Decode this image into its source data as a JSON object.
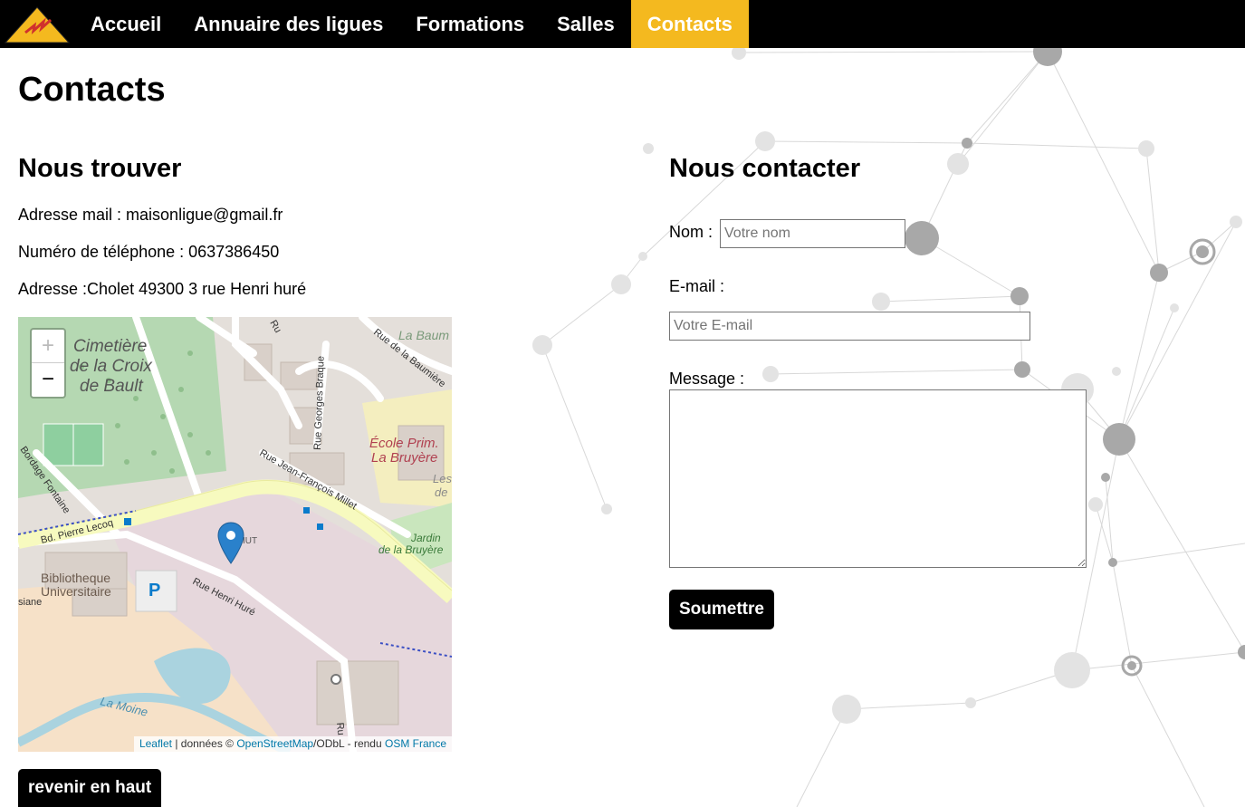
{
  "nav": {
    "items": [
      {
        "label": "Accueil"
      },
      {
        "label": "Annuaire des ligues"
      },
      {
        "label": "Formations"
      },
      {
        "label": "Salles"
      },
      {
        "label": "Contacts"
      }
    ],
    "active": "Contacts",
    "active_color": "#f4b91f",
    "background": "#000000"
  },
  "page": {
    "title": "Contacts"
  },
  "find_us": {
    "title": "Nous trouver",
    "email_line": "Adresse mail : maisonligue@gmail.fr",
    "phone_line": "Numéro de téléphone : 0637386450",
    "address_line": "Adresse :Cholet 49300 3 rue Henri huré"
  },
  "map": {
    "zoom_in": "+",
    "zoom_out": "−",
    "labels": {
      "cemetery_1": "Cimetière",
      "cemetery_2": "de la Croix",
      "cemetery_3": "de Bault",
      "school_1": "École Prim.",
      "school_2": "La Bruyère",
      "garden_1": "Jardin",
      "garden_2": "de la Bruyère",
      "library_1": "Bibliotheque",
      "library_2": "Universitaire",
      "iut": "IUT",
      "parking": "P",
      "la_baum": "La Baum",
      "les": "Les",
      "de": "de",
      "siane": "siane",
      "road_pierre_lecoq": "Bd. Pierre Lecoq",
      "road_henri_hure": "Rue Henri Huré",
      "road_jf_millet": "Rue Jean-François Millet",
      "road_georges_braque": "Rue Georges Braque",
      "road_baumiere": "Rue de la Baumière",
      "road_bordage": "Bordage Fontaine",
      "river": "La Moine",
      "ru_top": "Ru",
      "ru_bottom": "Ru"
    },
    "attribution": {
      "leaflet": "Leaflet",
      "sep1": " | données © ",
      "osm": "OpenStreetMap",
      "sep2": "/ODbL - rendu ",
      "osm_france": "OSM France"
    },
    "marker_color": "#2a81cb",
    "link_color": "#0078a8"
  },
  "back_to_top": {
    "label": "revenir en haut"
  },
  "contact_form": {
    "title": "Nous contacter",
    "name_label": "Nom :",
    "name_placeholder": "Votre nom",
    "email_label": "E-mail :",
    "email_placeholder": "Votre E-mail",
    "message_label": "Message :",
    "submit_label": "Soumettre"
  }
}
